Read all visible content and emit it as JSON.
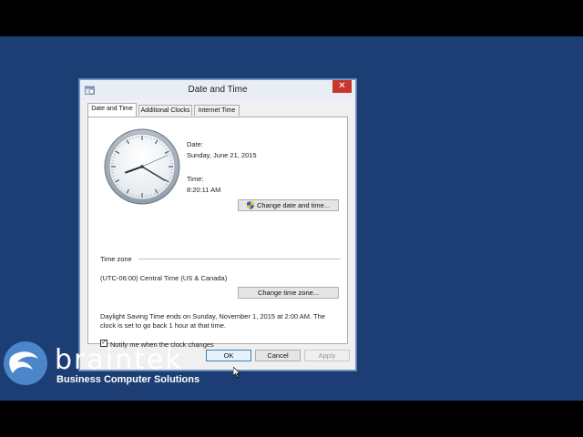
{
  "window": {
    "title": "Date and Time",
    "close_glyph": "✕"
  },
  "tabs": [
    {
      "label": "Date and Time",
      "active": true
    },
    {
      "label": "Additional Clocks",
      "active": false
    },
    {
      "label": "Internet Time",
      "active": false
    }
  ],
  "date_time": {
    "date_label": "Date:",
    "date_value": "Sunday, June 21, 2015",
    "time_label": "Time:",
    "time_value": "8:20:11 AM",
    "change_button": "Change date and time..."
  },
  "clock": {
    "hour": 8,
    "minute": 20,
    "second": 11
  },
  "time_zone": {
    "header": "Time zone",
    "value": "(UTC-06:00) Central Time (US & Canada)",
    "change_button": "Change time zone..."
  },
  "dst_notice": {
    "line1": "Daylight Saving Time ends on Sunday, November 1, 2015 at 2:00 AM. The",
    "line2": "clock is set to go back 1 hour at that time."
  },
  "notify": {
    "label": "Notify me when the clock changes",
    "checked": true,
    "check_glyph": "✓"
  },
  "footer": {
    "ok": "OK",
    "cancel": "Cancel",
    "apply": "Apply"
  },
  "branding": {
    "name": "braintek",
    "tagline": "Business Computer Solutions"
  },
  "colors": {
    "desktop": "#1c3e74",
    "close": "#c7372e",
    "primary_border": "#3c7fb1"
  },
  "icons": [
    "date-time-app-icon",
    "close-icon",
    "uac-shield-icon",
    "analog-clock-icon",
    "checkmark-icon",
    "braintek-logo",
    "mouse-cursor-icon"
  ]
}
